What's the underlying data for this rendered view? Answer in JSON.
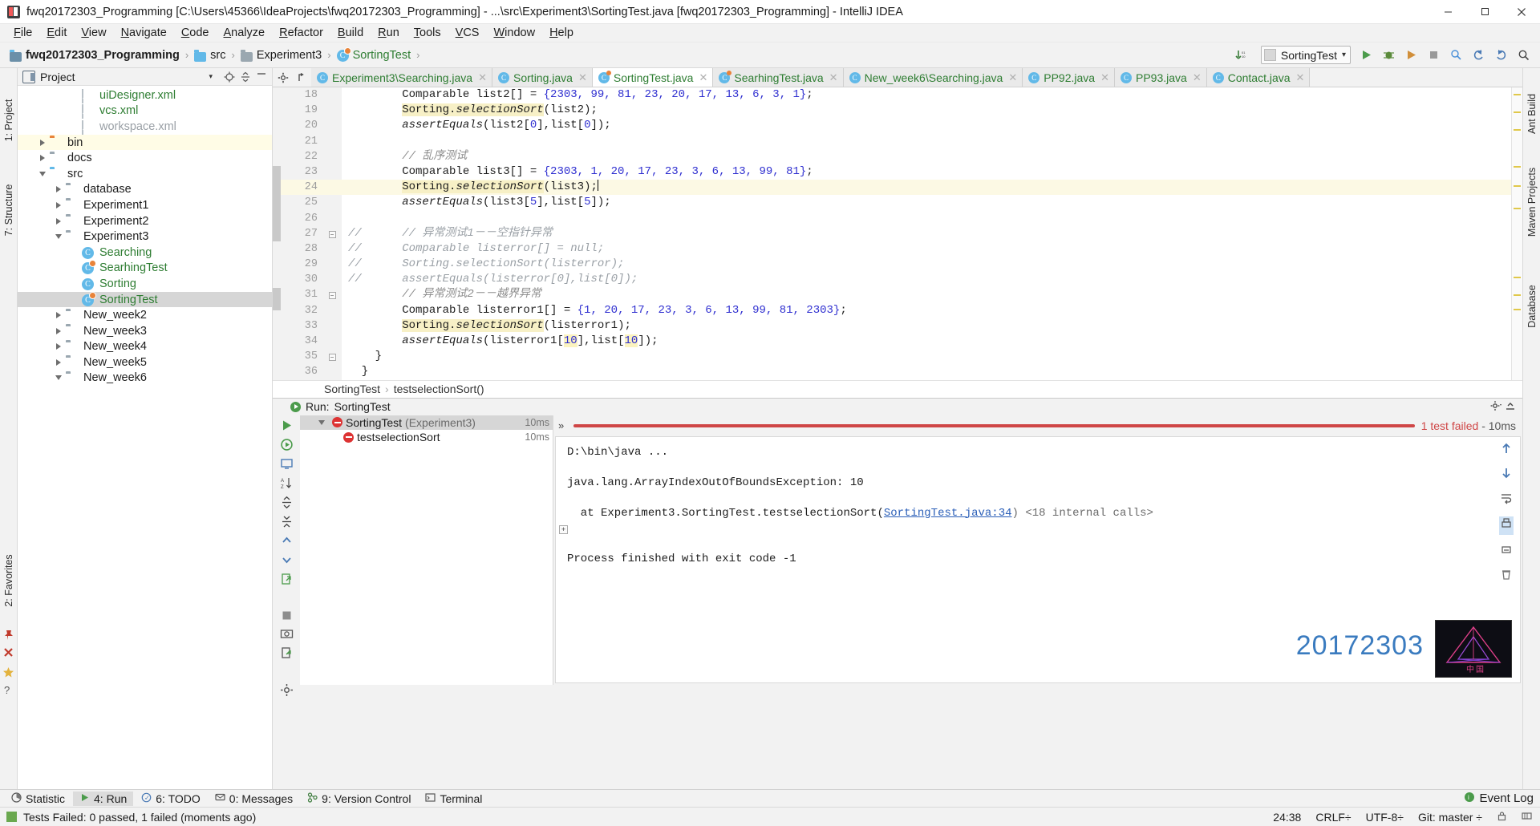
{
  "window": {
    "title": "fwq20172303_Programming [C:\\Users\\45366\\IdeaProjects\\fwq20172303_Programming] - ...\\src\\Experiment3\\SortingTest.java [fwq20172303_Programming] - IntelliJ IDEA",
    "app_icon": "intellij-idea-icon",
    "minimize": "minimize-icon",
    "maximize": "maximize-icon",
    "close": "close-icon"
  },
  "menubar": [
    "File",
    "Edit",
    "View",
    "Navigate",
    "Code",
    "Analyze",
    "Refactor",
    "Build",
    "Run",
    "Tools",
    "VCS",
    "Window",
    "Help"
  ],
  "navbar": {
    "breadcrumbs": [
      {
        "label": "fwq20172303_Programming",
        "icon": "module-icon"
      },
      {
        "label": "src",
        "icon": "source-folder-icon"
      },
      {
        "label": "Experiment3",
        "icon": "folder-icon"
      },
      {
        "label": "SortingTest",
        "icon": "java-test-class-icon"
      }
    ],
    "run_config": "SortingTest",
    "buttons": [
      "update-project-icon",
      "run-icon",
      "debug-icon",
      "run-with-coverage-icon",
      "stop-icon",
      "inspect-icon",
      "search-everywhere-icon"
    ]
  },
  "project_panel": {
    "title": "Project",
    "tree": [
      {
        "label": "uiDesigner.xml",
        "icon": "xml-file-icon",
        "indent": 3,
        "arrow": "",
        "color": "green",
        "state": ""
      },
      {
        "label": "vcs.xml",
        "icon": "xml-file-icon",
        "indent": 3,
        "arrow": "",
        "color": "green",
        "state": ""
      },
      {
        "label": "workspace.xml",
        "icon": "xml-file-icon",
        "indent": 3,
        "arrow": "",
        "color": "gray",
        "state": ""
      },
      {
        "label": "bin",
        "icon": "folder-orange-icon",
        "indent": 1,
        "arrow": "right",
        "color": "",
        "state": "highlight"
      },
      {
        "label": "docs",
        "icon": "folder-gray-icon",
        "indent": 1,
        "arrow": "right",
        "color": "",
        "state": ""
      },
      {
        "label": "src",
        "icon": "folder-blue-icon",
        "indent": 1,
        "arrow": "down",
        "color": "",
        "state": ""
      },
      {
        "label": "database",
        "icon": "folder-gray-icon",
        "indent": 2,
        "arrow": "right",
        "color": "",
        "state": ""
      },
      {
        "label": "Experiment1",
        "icon": "folder-gray-icon",
        "indent": 2,
        "arrow": "right",
        "color": "",
        "state": ""
      },
      {
        "label": "Experiment2",
        "icon": "folder-gray-icon",
        "indent": 2,
        "arrow": "right",
        "color": "",
        "state": ""
      },
      {
        "label": "Experiment3",
        "icon": "folder-gray-icon",
        "indent": 2,
        "arrow": "down",
        "color": "",
        "state": ""
      },
      {
        "label": "Searching",
        "icon": "java-class-icon",
        "indent": 3,
        "arrow": "",
        "color": "green",
        "state": ""
      },
      {
        "label": "SearhingTest",
        "icon": "java-test-class-icon",
        "indent": 3,
        "arrow": "",
        "color": "green",
        "state": ""
      },
      {
        "label": "Sorting",
        "icon": "java-class-icon",
        "indent": 3,
        "arrow": "",
        "color": "green",
        "state": ""
      },
      {
        "label": "SortingTest",
        "icon": "java-test-class-icon",
        "indent": 3,
        "arrow": "",
        "color": "green",
        "state": "selected"
      },
      {
        "label": "New_week2",
        "icon": "folder-gray-icon",
        "indent": 2,
        "arrow": "right",
        "color": "",
        "state": ""
      },
      {
        "label": "New_week3",
        "icon": "folder-gray-icon",
        "indent": 2,
        "arrow": "right",
        "color": "",
        "state": ""
      },
      {
        "label": "New_week4",
        "icon": "folder-gray-icon",
        "indent": 2,
        "arrow": "right",
        "color": "",
        "state": ""
      },
      {
        "label": "New_week5",
        "icon": "folder-gray-icon",
        "indent": 2,
        "arrow": "right",
        "color": "",
        "state": ""
      },
      {
        "label": "New_week6",
        "icon": "folder-gray-icon",
        "indent": 2,
        "arrow": "down",
        "color": "",
        "state": ""
      }
    ]
  },
  "left_strip": [
    "1: Project",
    "7: Structure"
  ],
  "left_strip_bottom": [
    "2: Favorites"
  ],
  "right_strip": [
    "Ant Build",
    "Maven Projects",
    "Database"
  ],
  "editor": {
    "tabs": [
      {
        "label": "Experiment3\\Searching.java",
        "icon": "java-class-icon",
        "active": false
      },
      {
        "label": "Sorting.java",
        "icon": "java-class-icon",
        "active": false
      },
      {
        "label": "SortingTest.java",
        "icon": "java-test-class-icon",
        "active": true
      },
      {
        "label": "SearhingTest.java",
        "icon": "java-test-class-icon",
        "active": false
      },
      {
        "label": "New_week6\\Searching.java",
        "icon": "java-class-icon",
        "active": false
      },
      {
        "label": "PP92.java",
        "icon": "java-class-icon",
        "active": false
      },
      {
        "label": "PP93.java",
        "icon": "java-class-icon",
        "active": false
      },
      {
        "label": "Contact.java",
        "icon": "java-class-icon",
        "active": false
      }
    ],
    "first_line_number": 18,
    "lines": [
      {
        "n": 18,
        "html": "        Comparable list2[] = <span class=\"num\">{2303, 99, 81, 23, 20, 17, 13, 6, 3, 1}</span>;",
        "caret": false,
        "fold": ""
      },
      {
        "n": 19,
        "html": "        <span class=\"hl-id\">Sorting.<span class=\"ital\">selectionSort</span></span>(list2);",
        "caret": false,
        "fold": ""
      },
      {
        "n": 20,
        "html": "        <span class=\"ital\">assertEquals</span>(list2[<span class=\"num\">0</span>],list[<span class=\"num\">0</span>]);",
        "caret": false,
        "fold": ""
      },
      {
        "n": 21,
        "html": "",
        "caret": false,
        "fold": ""
      },
      {
        "n": 22,
        "html": "        <span class=\"cmt\">// 乱序测试</span>",
        "caret": false,
        "fold": ""
      },
      {
        "n": 23,
        "html": "        Comparable list3[] = <span class=\"num\">{2303, 1, 20, 17, 23, 3, 6, 13, 99, 81}</span>;",
        "caret": false,
        "fold": ""
      },
      {
        "n": 24,
        "html": "        <span class=\"hl-id\">Sorting.<span class=\"ital\">selectionSort</span></span>(list3);<span class=\"caret-bar\"></span>",
        "caret": true,
        "fold": ""
      },
      {
        "n": 25,
        "html": "        <span class=\"ital\">assertEquals</span>(list3[<span class=\"num\">5</span>],list[<span class=\"num\">5</span>]);",
        "caret": false,
        "fold": ""
      },
      {
        "n": 26,
        "html": "",
        "caret": false,
        "fold": ""
      },
      {
        "n": 27,
        "html": "<span class=\"cmt2\">//      // 异常测试1－－空指针异常</span>",
        "caret": false,
        "fold": "minus"
      },
      {
        "n": 28,
        "html": "<span class=\"cmt2\">//      Comparable listerror[] = null;</span>",
        "caret": false,
        "fold": ""
      },
      {
        "n": 29,
        "html": "<span class=\"cmt2\">//      Sorting.selectionSort(listerror);</span>",
        "caret": false,
        "fold": ""
      },
      {
        "n": 30,
        "html": "<span class=\"cmt2\">//      assertEquals(listerror[0],list[0]);</span>",
        "caret": false,
        "fold": ""
      },
      {
        "n": 31,
        "html": "        <span class=\"cmt\">// 异常测试2－－越界异常</span>",
        "caret": false,
        "fold": "minus"
      },
      {
        "n": 32,
        "html": "        Comparable listerror1[] = <span class=\"num\">{1, 20, 17, 23, 3, 6, 13, 99, 81, 2303}</span>;",
        "caret": false,
        "fold": ""
      },
      {
        "n": 33,
        "html": "        <span class=\"hl-id\">Sorting.<span class=\"ital\">selectionSort</span></span>(listerror1);",
        "caret": false,
        "fold": ""
      },
      {
        "n": 34,
        "html": "        <span class=\"ital\">assertEquals</span>(listerror1[<span class=\"hl-n num\">10</span>],list[<span class=\"hl-n num\">10</span>]);",
        "caret": false,
        "fold": ""
      },
      {
        "n": 35,
        "html": "    }",
        "caret": false,
        "fold": "minus"
      },
      {
        "n": 36,
        "html": "  }",
        "caret": false,
        "fold": ""
      }
    ],
    "breadcrumb": [
      "SortingTest",
      "testselectionSort()"
    ]
  },
  "run_panel": {
    "header_label": "Run:",
    "header_config": "SortingTest",
    "tree": [
      {
        "label": "SortingTest",
        "suffix": " (Experiment3)",
        "time": "10ms",
        "indent": 1,
        "arrow": "down",
        "selected": true
      },
      {
        "label": "testselectionSort",
        "suffix": "",
        "time": "10ms",
        "indent": 2,
        "arrow": "",
        "selected": false
      }
    ],
    "progress_text": "1 test failed",
    "progress_time": " - 10ms",
    "progress_color": "#cf4646",
    "console": [
      {
        "text": "D:\\bin\\java ...",
        "style": "cmd"
      },
      {
        "text": "",
        "style": "plain"
      },
      {
        "text": "java.lang.ArrayIndexOutOfBoundsException: 10",
        "style": "plain"
      },
      {
        "text": "",
        "style": "plain"
      },
      {
        "text": "  at Experiment3.SortingTest.testselectionSort(",
        "link": "SortingTest.java:34",
        "after": ") <18 internal calls>",
        "style": "stack"
      },
      {
        "text": "",
        "style": "plain"
      },
      {
        "text": "",
        "style": "plain"
      },
      {
        "text": "Process finished with exit code -1",
        "style": "plain"
      }
    ],
    "watermark": "20172303",
    "toolbar_icons": [
      "rerun-icon",
      "rerun-failed-icon",
      "toggle-auto-test-icon",
      "sort-alphabetically-icon",
      "expand-all-icon",
      "collapse-all-icon",
      "prev-test-icon",
      "next-test-icon",
      "export-test-results-icon"
    ],
    "side_icons": [
      "stop-icon",
      "camera-icon",
      "pin-icon",
      "close-icon",
      "settings-icon"
    ],
    "console_icons": [
      "scroll-up-icon",
      "scroll-down-icon",
      "soft-wrap-icon",
      "print-icon",
      "clear-all-icon"
    ]
  },
  "tool_window_bar": {
    "items": [
      {
        "label": "Statistic",
        "icon": "statistic-icon",
        "active": false
      },
      {
        "label": "4: Run",
        "icon": "run-icon",
        "active": true
      },
      {
        "label": "6: TODO",
        "icon": "todo-icon",
        "active": false
      },
      {
        "label": "0: Messages",
        "icon": "messages-icon",
        "active": false
      },
      {
        "label": "9: Version Control",
        "icon": "version-control-icon",
        "active": false
      },
      {
        "label": "Terminal",
        "icon": "terminal-icon",
        "active": false
      }
    ],
    "event_log": "Event Log"
  },
  "statusbar": {
    "message": "Tests Failed: 0 passed, 1 failed (moments ago)",
    "caret_position": "24:38",
    "line_separator": "CRLF",
    "encoding": "UTF-8",
    "branch": "Git: master"
  },
  "colors": {
    "accent_blue": "#3a7bbf",
    "fail_red": "#cf4646",
    "green_text": "#2e7d32",
    "highlight_yellow": "#fcf9e4"
  }
}
